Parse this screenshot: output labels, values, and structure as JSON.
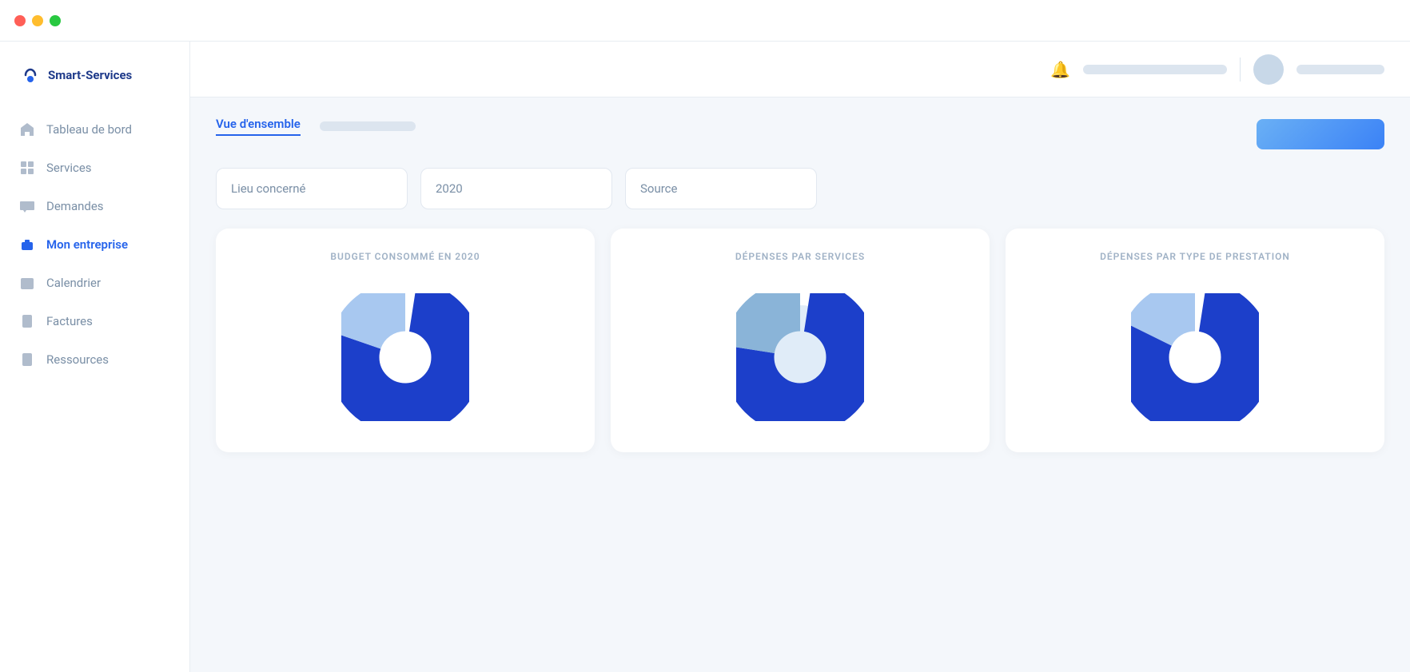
{
  "titlebar": {
    "dots": [
      "red",
      "yellow",
      "green"
    ]
  },
  "logo": {
    "text": "Smart-Services"
  },
  "nav": {
    "items": [
      {
        "id": "tableau-de-bord",
        "label": "Tableau de bord",
        "icon": "home",
        "active": false
      },
      {
        "id": "services",
        "label": "Services",
        "icon": "grid",
        "active": false
      },
      {
        "id": "demandes",
        "label": "Demandes",
        "icon": "chat",
        "active": false
      },
      {
        "id": "mon-entreprise",
        "label": "Mon entreprise",
        "icon": "briefcase",
        "active": true
      },
      {
        "id": "calendrier",
        "label": "Calendrier",
        "icon": "calendar",
        "active": false
      },
      {
        "id": "factures",
        "label": "Factures",
        "icon": "file-text",
        "active": false
      },
      {
        "id": "ressources",
        "label": "Ressources",
        "icon": "document",
        "active": false
      }
    ]
  },
  "tabs": {
    "active": "Vue d'ensemble"
  },
  "filters": {
    "lieu": "Lieu concerné",
    "year": "2020",
    "source": "Source"
  },
  "charts": [
    {
      "id": "budget",
      "title": "BUDGET CONSOMMÉ EN 2020",
      "dark_slice_pct": 78,
      "light_slice_pct": 22
    },
    {
      "id": "services",
      "title": "DÉPENSES PAR SERVICES",
      "dark_slice_pct": 75,
      "light_slice_pct": 25
    },
    {
      "id": "prestation",
      "title": "DÉPENSES PAR TYPE DE PRESTATION",
      "dark_slice_pct": 80,
      "light_slice_pct": 20
    }
  ],
  "colors": {
    "dark_blue": "#1c3fca",
    "light_blue": "#a8c8f0",
    "accent": "#2563eb"
  }
}
